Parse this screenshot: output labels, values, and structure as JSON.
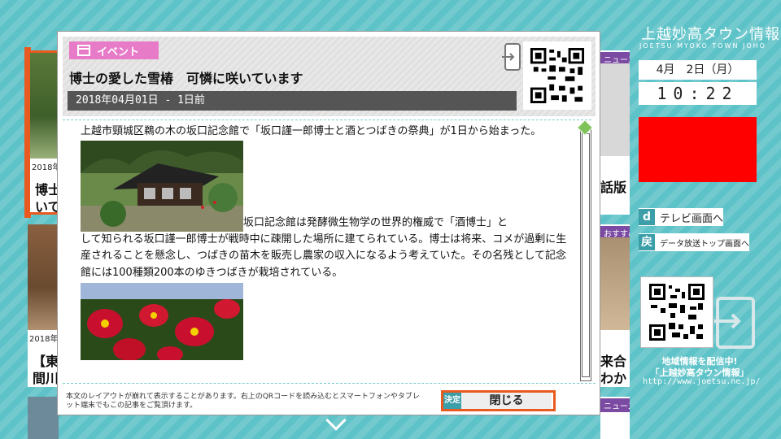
{
  "brand": {
    "title": "上越妙高タウン情報",
    "subtitle": "JOETSU MYOKO TOWN JOHO"
  },
  "clock": {
    "date": "4月　2日（月）",
    "time": "10:22"
  },
  "right_buttons": {
    "tv": {
      "key": "d",
      "label": "テレビ画面へ"
    },
    "top": {
      "key": "戻",
      "label": "データ放送トップ画面へ"
    }
  },
  "promo": {
    "line1": "地域情報を配信中!",
    "line2": "「上越妙高タウン情報」",
    "url": "http://www.joetsu.ne.jp/"
  },
  "background": {
    "left_date1": "2018年",
    "left_line1": "博士",
    "left_line2": "いて",
    "left_date2": "2018年",
    "left_line3": "【東",
    "left_line4": "間川",
    "right_tag1": "ニュース",
    "right_text1": "話版",
    "right_tag2": "おすすめ",
    "right_text2": "来合",
    "right_text3": "わか",
    "right_tag3": "ニュース"
  },
  "modal": {
    "category": "イベント",
    "title": "博士の愛した雪椿　可憐に咲いています",
    "date_line": "2018年04月01日 - 1日前",
    "paragraph1": "上越市頸城区鵜の木の坂口記念館で「坂口謹一郎博士と酒とつばきの祭典」が1日から始まった。",
    "paragraph2_lead": "坂口記念館は発酵微生物学の世界的権威で「酒博士」と",
    "paragraph2_rest": "して知られる坂口謹一郎博士が戦時中に疎開した場所に建てられている。博士は将来、コメが過剰に生産されることを懸念し、つばきの苗木を販売し農家の収入になるよう考えていた。その名残として記念館には100種類200本のゆきつばきが栽培されている。",
    "footer_note": "本文のレイアウトが崩れて表示することがあります。右上のQRコードを読み込むとスマートフォンやタブレット端末でもこの記事をご覧頂けます。",
    "ok_key": "決定",
    "close_label": "閉じる"
  },
  "colors": {
    "teal": "#5ec3c8",
    "orange": "#e85a1f",
    "pink": "#e87bc8",
    "red": "#ff0000"
  }
}
